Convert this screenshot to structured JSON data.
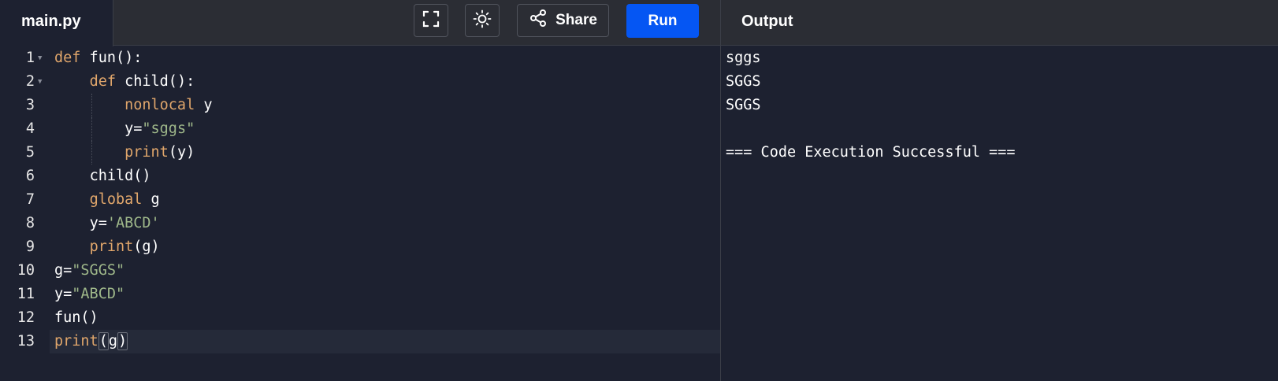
{
  "file_tab": {
    "label": "main.py"
  },
  "toolbar": {
    "fullscreen_icon": "fullscreen-icon",
    "theme_icon": "sun-icon",
    "share_label": "Share",
    "share_icon": "share-icon",
    "run_label": "Run"
  },
  "output_panel": {
    "title": "Output",
    "lines": [
      "sggs",
      "SGGS",
      "SGGS",
      "",
      "=== Code Execution Successful ==="
    ]
  },
  "editor": {
    "lines": [
      {
        "number": "1",
        "foldable": true,
        "indent": "",
        "tokens": [
          {
            "t": "def",
            "c": "kw"
          },
          {
            "t": " fun():",
            "c": ""
          }
        ]
      },
      {
        "number": "2",
        "foldable": true,
        "indent": "    ",
        "tokens": [
          {
            "t": "def",
            "c": "kw"
          },
          {
            "t": " child():",
            "c": ""
          }
        ]
      },
      {
        "number": "3",
        "foldable": false,
        "indent": "        ",
        "guide": true,
        "tokens": [
          {
            "t": "nonlocal",
            "c": "kw"
          },
          {
            "t": " y",
            "c": ""
          }
        ]
      },
      {
        "number": "4",
        "foldable": false,
        "indent": "        ",
        "guide": true,
        "tokens": [
          {
            "t": "y=",
            "c": ""
          },
          {
            "t": "\"sggs\"",
            "c": "str"
          }
        ]
      },
      {
        "number": "5",
        "foldable": false,
        "indent": "        ",
        "guide": true,
        "tokens": [
          {
            "t": "print",
            "c": "kw"
          },
          {
            "t": "(y)",
            "c": ""
          }
        ]
      },
      {
        "number": "6",
        "foldable": false,
        "indent": "    ",
        "tokens": [
          {
            "t": "child()",
            "c": ""
          }
        ]
      },
      {
        "number": "7",
        "foldable": false,
        "indent": "    ",
        "tokens": [
          {
            "t": "global",
            "c": "kw"
          },
          {
            "t": " g",
            "c": ""
          }
        ]
      },
      {
        "number": "8",
        "foldable": false,
        "indent": "    ",
        "tokens": [
          {
            "t": "y=",
            "c": ""
          },
          {
            "t": "'ABCD'",
            "c": "str"
          }
        ]
      },
      {
        "number": "9",
        "foldable": false,
        "indent": "    ",
        "tokens": [
          {
            "t": "print",
            "c": "kw"
          },
          {
            "t": "(g)",
            "c": ""
          }
        ]
      },
      {
        "number": "10",
        "foldable": false,
        "indent": "",
        "tokens": [
          {
            "t": "g=",
            "c": ""
          },
          {
            "t": "\"SGGS\"",
            "c": "str"
          }
        ]
      },
      {
        "number": "11",
        "foldable": false,
        "indent": "",
        "tokens": [
          {
            "t": "y=",
            "c": ""
          },
          {
            "t": "\"ABCD\"",
            "c": "str"
          }
        ]
      },
      {
        "number": "12",
        "foldable": false,
        "indent": "",
        "tokens": [
          {
            "t": "fun()",
            "c": ""
          }
        ]
      },
      {
        "number": "13",
        "foldable": false,
        "indent": "",
        "active": true,
        "tokens": [
          {
            "t": "print",
            "c": "kw"
          },
          {
            "t": "(",
            "c": "",
            "box": true
          },
          {
            "t": "g",
            "c": ""
          },
          {
            "t": ")",
            "c": "",
            "box": true
          }
        ]
      }
    ]
  },
  "colors": {
    "background": "#1d2130",
    "topbar": "#2b2d34",
    "run_button": "#0556f3",
    "keyword": "#e0a66b",
    "string": "#9fb88a"
  }
}
